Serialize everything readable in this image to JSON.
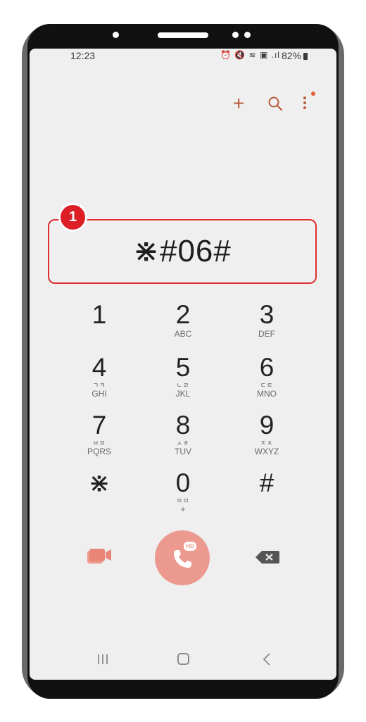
{
  "status_bar": {
    "time": "12:23",
    "icons_text": "⏰ 🔇 ≋ ▣ .ıl",
    "battery": "82%"
  },
  "top_actions": {
    "add_label": "+"
  },
  "dialer": {
    "number": "⋇#06#",
    "step_badge": "1"
  },
  "keypad": [
    {
      "digit": "1",
      "hangul": "",
      "letters": ""
    },
    {
      "digit": "2",
      "hangul": "",
      "letters": "ABC"
    },
    {
      "digit": "3",
      "hangul": "",
      "letters": "DEF"
    },
    {
      "digit": "4",
      "hangul": "ㄱㅋ",
      "letters": "GHI"
    },
    {
      "digit": "5",
      "hangul": "ㄴㄹ",
      "letters": "JKL"
    },
    {
      "digit": "6",
      "hangul": "ㄷㅌ",
      "letters": "MNO"
    },
    {
      "digit": "7",
      "hangul": "ㅂㅍ",
      "letters": "PQRS"
    },
    {
      "digit": "8",
      "hangul": "ㅅㅎ",
      "letters": "TUV"
    },
    {
      "digit": "9",
      "hangul": "ㅈㅊ",
      "letters": "WXYZ"
    },
    {
      "digit": "⋇",
      "hangul": "",
      "letters": ""
    },
    {
      "digit": "0",
      "hangul": "ㅇㅁ",
      "letters": "+"
    },
    {
      "digit": "#",
      "hangul": "",
      "letters": ""
    }
  ],
  "call": {
    "hd_label": "HD"
  },
  "colors": {
    "accent": "#b85c3a",
    "call_button": "#ec9a90",
    "highlight": "#e02d2d"
  }
}
